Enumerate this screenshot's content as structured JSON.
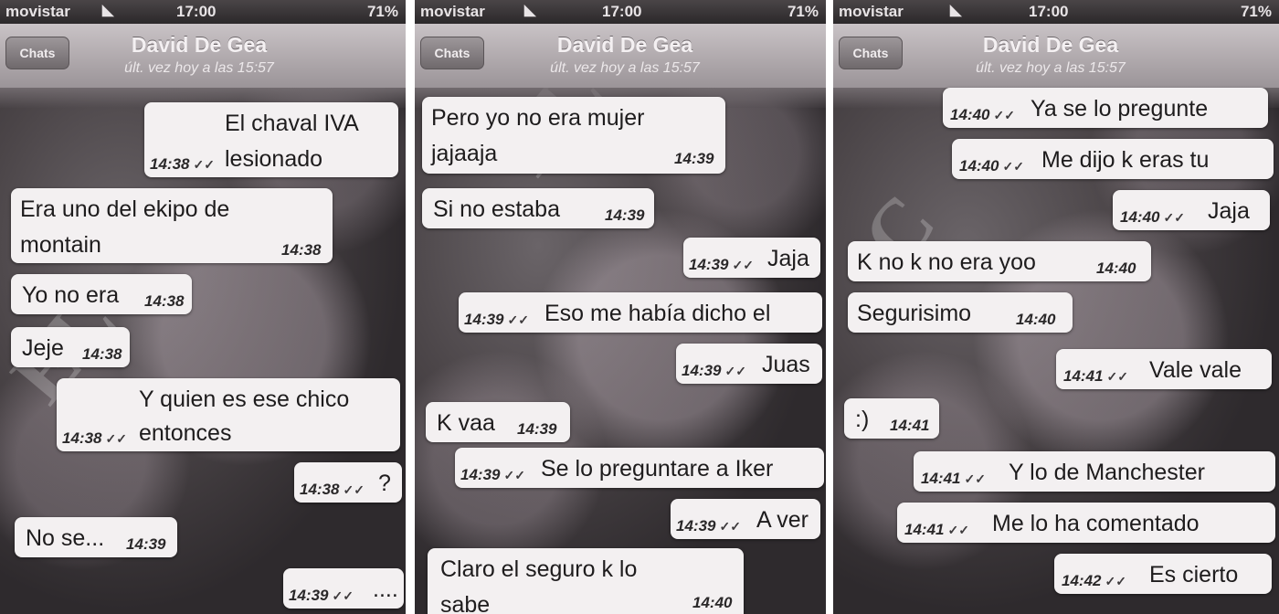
{
  "status_bar": {
    "carrier": "movistar",
    "time": "17:00",
    "battery": "71%"
  },
  "contact": {
    "back_label": "Chats",
    "name": "David De Gea",
    "last_seen": "últ. vez hoy a las 15:57"
  },
  "watermark": "EL CONFIDENCIAL",
  "panels": [
    {
      "messages": [
        {
          "text": "El chaval IVA",
          "text2": "lesionado",
          "time": "14:38",
          "outgoing": true
        },
        {
          "text": "Era uno del ekipo de",
          "text2": "montain",
          "time": "14:38",
          "outgoing": false
        },
        {
          "text": "Yo no era",
          "time": "14:38",
          "outgoing": false
        },
        {
          "text": "Jeje",
          "time": "14:38",
          "outgoing": false
        },
        {
          "text": "Y quien es ese chico",
          "text2": "entonces",
          "time": "14:38",
          "outgoing": true
        },
        {
          "text": "?",
          "time": "14:38",
          "outgoing": true
        },
        {
          "text": "No se...",
          "time": "14:39",
          "outgoing": false
        },
        {
          "text": "....",
          "time": "14:39",
          "outgoing": true
        }
      ]
    },
    {
      "messages": [
        {
          "text": "Pero yo no era mujer",
          "text2": "jajaaja",
          "time": "14:39",
          "outgoing": false
        },
        {
          "text": "Si no estaba",
          "time": "14:39",
          "outgoing": false
        },
        {
          "text": "Jaja",
          "time": "14:39",
          "outgoing": true
        },
        {
          "text": "Eso me había dicho el",
          "time": "14:39",
          "outgoing": true
        },
        {
          "text": "Juas",
          "time": "14:39",
          "outgoing": true
        },
        {
          "text": "K vaa",
          "time": "14:39",
          "outgoing": false
        },
        {
          "text": "Se lo preguntare a Iker",
          "time": "14:39",
          "outgoing": true
        },
        {
          "text": "A ver",
          "time": "14:39",
          "outgoing": true
        },
        {
          "text": "Claro el seguro k lo",
          "text2": "sabe",
          "time": "14:40",
          "outgoing": false
        }
      ]
    },
    {
      "messages": [
        {
          "text": "Ya se lo pregunte",
          "time": "14:40",
          "outgoing": true
        },
        {
          "text": "Me dijo k eras tu",
          "time": "14:40",
          "outgoing": true
        },
        {
          "text": "Jaja",
          "time": "14:40",
          "outgoing": true
        },
        {
          "text": "K no k no era yoo",
          "time": "14:40",
          "outgoing": false
        },
        {
          "text": "Segurisimo",
          "time": "14:40",
          "outgoing": false
        },
        {
          "text": "Vale vale",
          "time": "14:41",
          "outgoing": true
        },
        {
          "text": ":)",
          "time": "14:41",
          "outgoing": false
        },
        {
          "text": "Y lo de Manchester",
          "time": "14:41",
          "outgoing": true
        },
        {
          "text": "Me lo ha comentado",
          "time": "14:41",
          "outgoing": true
        },
        {
          "text": "Es cierto",
          "time": "14:42",
          "outgoing": true
        }
      ]
    }
  ]
}
